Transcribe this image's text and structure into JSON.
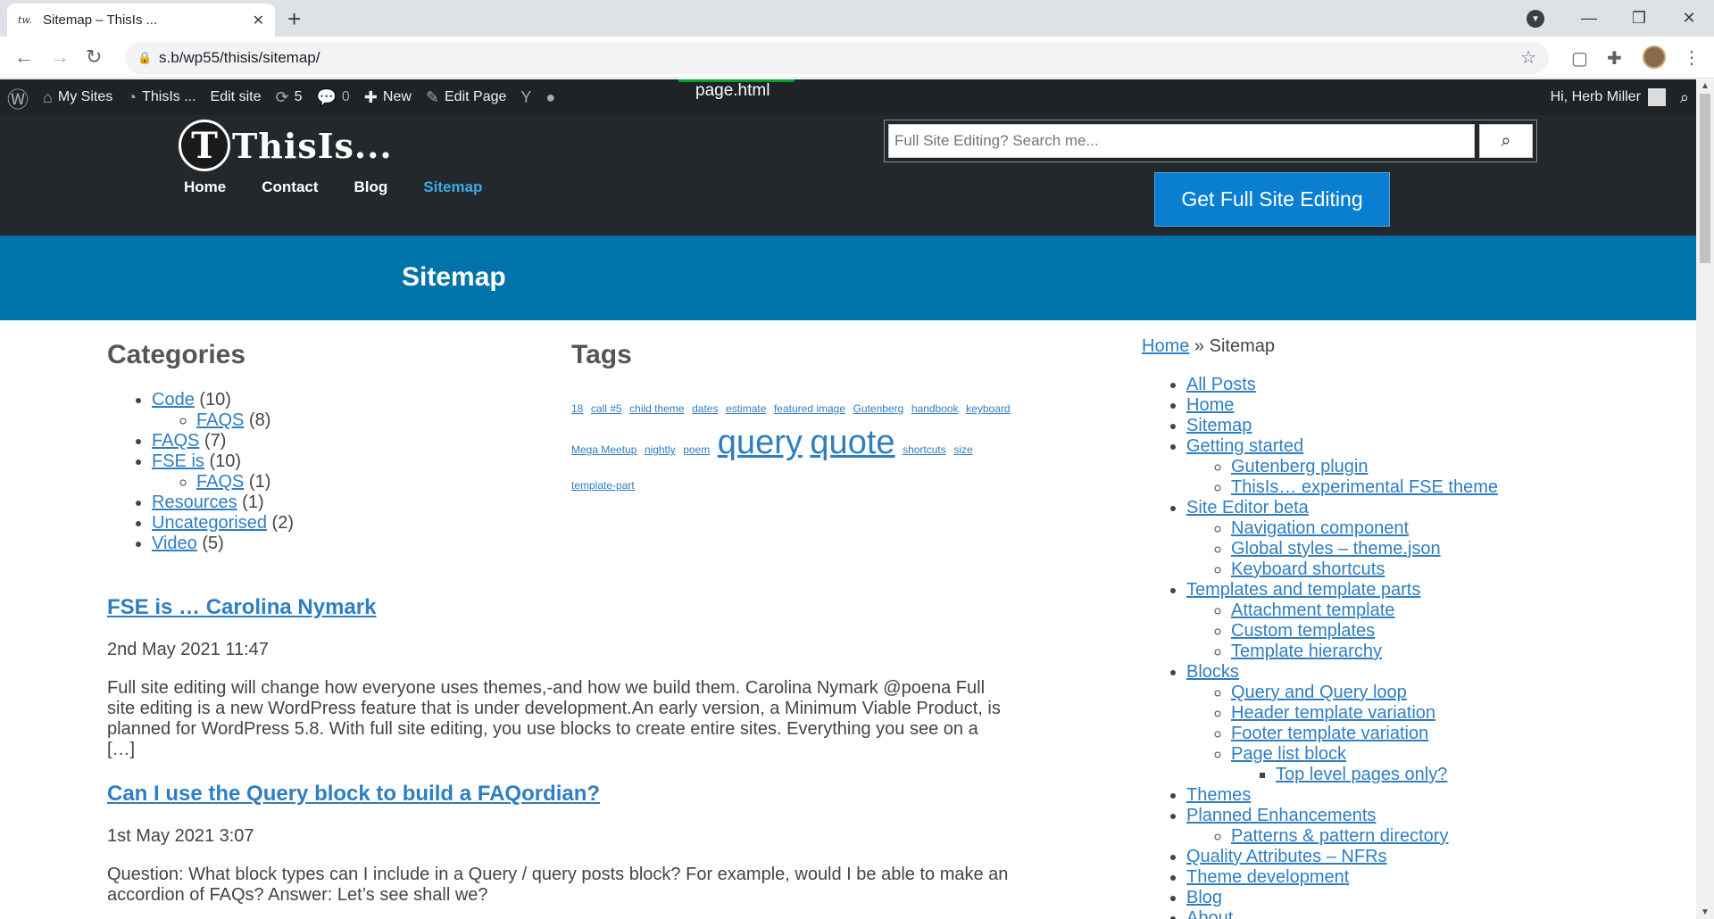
{
  "browser": {
    "tab_title": "Sitemap – ThisIs ...",
    "favicon_text": "tw.",
    "url": "s.b/wp55/thisis/sitemap/"
  },
  "adminbar": {
    "my_sites": "My Sites",
    "site_name": "ThisIs ...",
    "edit_site": "Edit site",
    "updates_count": "5",
    "comments_count": "0",
    "new": "New",
    "edit_page": "Edit Page",
    "template_label": "page.html",
    "greeting": "Hi, Herb Miller"
  },
  "site": {
    "logo_letter": "T",
    "logo_text": "ThisIs...",
    "nav": [
      "Home",
      "Contact",
      "Blog",
      "Sitemap"
    ],
    "search_placeholder": "Full Site Editing? Search me...",
    "cta": "Get Full Site Editing"
  },
  "page": {
    "title": "Sitemap"
  },
  "categories": {
    "heading": "Categories",
    "items": [
      {
        "name": "Code",
        "count": "(10)",
        "children": [
          {
            "name": "FAQS",
            "count": "(8)"
          }
        ]
      },
      {
        "name": "FAQS",
        "count": "(7)",
        "children": []
      },
      {
        "name": "FSE is",
        "count": "(10)",
        "children": [
          {
            "name": "FAQS",
            "count": "(1)"
          }
        ]
      },
      {
        "name": "Resources",
        "count": "(1)",
        "children": []
      },
      {
        "name": "Uncategorised",
        "count": "(2)",
        "children": []
      },
      {
        "name": "Video",
        "count": "(5)",
        "children": []
      }
    ]
  },
  "tags": {
    "heading": "Tags",
    "items": [
      {
        "name": "18",
        "size": "sm"
      },
      {
        "name": "call #5",
        "size": "sm"
      },
      {
        "name": "child theme",
        "size": "sm"
      },
      {
        "name": "dates",
        "size": "sm"
      },
      {
        "name": "estimate",
        "size": "sm"
      },
      {
        "name": "featured image",
        "size": "sm"
      },
      {
        "name": "Gutenberg",
        "size": "sm"
      },
      {
        "name": "handbook",
        "size": "sm"
      },
      {
        "name": "keyboard",
        "size": "sm"
      },
      {
        "name": "Mega Meetup",
        "size": "sm"
      },
      {
        "name": "nightly",
        "size": "sm"
      },
      {
        "name": "poem",
        "size": "sm"
      },
      {
        "name": "query",
        "size": "lg"
      },
      {
        "name": "quote",
        "size": "lg"
      },
      {
        "name": "shortcuts",
        "size": "sm"
      },
      {
        "name": "size",
        "size": "sm"
      },
      {
        "name": "template-part",
        "size": "sm"
      }
    ]
  },
  "posts": [
    {
      "title": "FSE is … Carolina Nymark",
      "date": "2nd May 2021 11:47",
      "excerpt": "Full site editing will change how everyone uses themes,-and how we build them. Carolina Nymark @poena Full site editing is a new WordPress feature that is under development.An early version, a Minimum Viable Product, is planned for WordPress 5.8. With full site editing, you use blocks to create entire sites. Everything you see on a […]"
    },
    {
      "title": "Can I use the Query block to build a FAQordian?",
      "date": "1st May 2021 3:07",
      "excerpt": "Question: What block types can I include in a Query / query posts block? For example, would I be able to make an accordion of FAQs? Answer: Let’s see shall we?"
    }
  ],
  "sidebar": {
    "breadcrumb_home": "Home",
    "breadcrumb_sep": "»",
    "breadcrumb_current": "Sitemap",
    "pages": [
      {
        "label": "All Posts",
        "children": []
      },
      {
        "label": "Home",
        "children": []
      },
      {
        "label": "Sitemap",
        "children": []
      },
      {
        "label": "Getting started",
        "children": [
          {
            "label": "Gutenberg plugin",
            "children": []
          },
          {
            "label": "ThisIs… experimental FSE theme",
            "children": []
          }
        ]
      },
      {
        "label": "Site Editor beta",
        "children": [
          {
            "label": "Navigation component",
            "children": []
          },
          {
            "label": "Global styles – theme.json",
            "children": []
          },
          {
            "label": "Keyboard shortcuts",
            "children": []
          }
        ]
      },
      {
        "label": "Templates and template parts",
        "children": [
          {
            "label": "Attachment template",
            "children": []
          },
          {
            "label": "Custom templates",
            "children": []
          },
          {
            "label": "Template hierarchy",
            "children": []
          }
        ]
      },
      {
        "label": "Blocks",
        "children": [
          {
            "label": "Query and Query loop",
            "children": []
          },
          {
            "label": "Header template variation",
            "children": []
          },
          {
            "label": "Footer template variation",
            "children": []
          },
          {
            "label": "Page list block",
            "children": [
              {
                "label": "Top level pages only?"
              }
            ]
          }
        ]
      },
      {
        "label": "Themes",
        "children": []
      },
      {
        "label": "Planned Enhancements",
        "children": [
          {
            "label": "Patterns & pattern directory",
            "children": []
          }
        ]
      },
      {
        "label": "Quality Attributes – NFRs",
        "children": []
      },
      {
        "label": "Theme development",
        "children": []
      },
      {
        "label": "Blog",
        "children": []
      },
      {
        "label": "About",
        "children": []
      }
    ]
  }
}
